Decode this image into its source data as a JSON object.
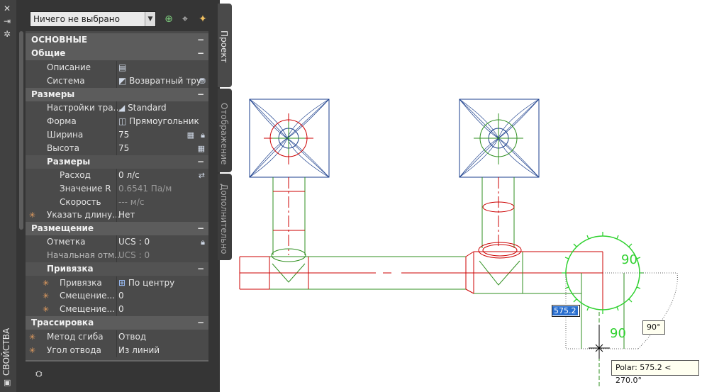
{
  "palette": {
    "title": "СВОЙСТВА",
    "selection": "Ничего не выбрано",
    "tabs": [
      "Проект",
      "Отображение",
      "Дополнительно"
    ],
    "groups": {
      "basic": "ОСНОВНЫЕ",
      "general": "Общие",
      "dimensions": "Размеры",
      "dimensions_sub": "Размеры",
      "placement": "Размещение",
      "snap": "Привязка",
      "routing": "Трассировка"
    },
    "props": {
      "description": {
        "label": "Описание",
        "value": ""
      },
      "system": {
        "label": "Система",
        "value": "Возвратный тру"
      },
      "duct_settings": {
        "label": "Настройки тра...",
        "value": "Standard"
      },
      "shape": {
        "label": "Форма",
        "value": "Прямоугольник"
      },
      "width": {
        "label": "Ширина",
        "value": "75"
      },
      "height": {
        "label": "Высота",
        "value": "75"
      },
      "flow": {
        "label": "Расход",
        "value": "0 л/с"
      },
      "r_value": {
        "label": "Значение R",
        "value": "0.6541 Па/м"
      },
      "velocity": {
        "label": "Скорость",
        "value": "--- м/с"
      },
      "specify_length": {
        "label": "Указать длину...",
        "value": "Нет"
      },
      "elevation": {
        "label": "Отметка",
        "value": "UCS : 0"
      },
      "start_elevation": {
        "label": "Начальная отм...",
        "value": "UCS : 0"
      },
      "snap": {
        "label": "Привязка",
        "value": "По центру"
      },
      "offset1": {
        "label": "Смещение...",
        "value": "0"
      },
      "offset2": {
        "label": "Смещение...",
        "value": "0"
      },
      "bend_method": {
        "label": "Метод сгиба",
        "value": "Отвод"
      },
      "elbow_angle": {
        "label": "Угол отвода",
        "value": "Из линий"
      }
    }
  },
  "canvas": {
    "dynamic_input": "575.2",
    "angle_tip": "90°",
    "polar_tip": "Polar: 575.2 < 270.0°",
    "compass_labels": [
      "90",
      "90"
    ],
    "colors": {
      "red": "#cc0000",
      "green": "#2f8f1f",
      "blue": "#1a3e8c",
      "glyph": "#2fd12f"
    }
  }
}
